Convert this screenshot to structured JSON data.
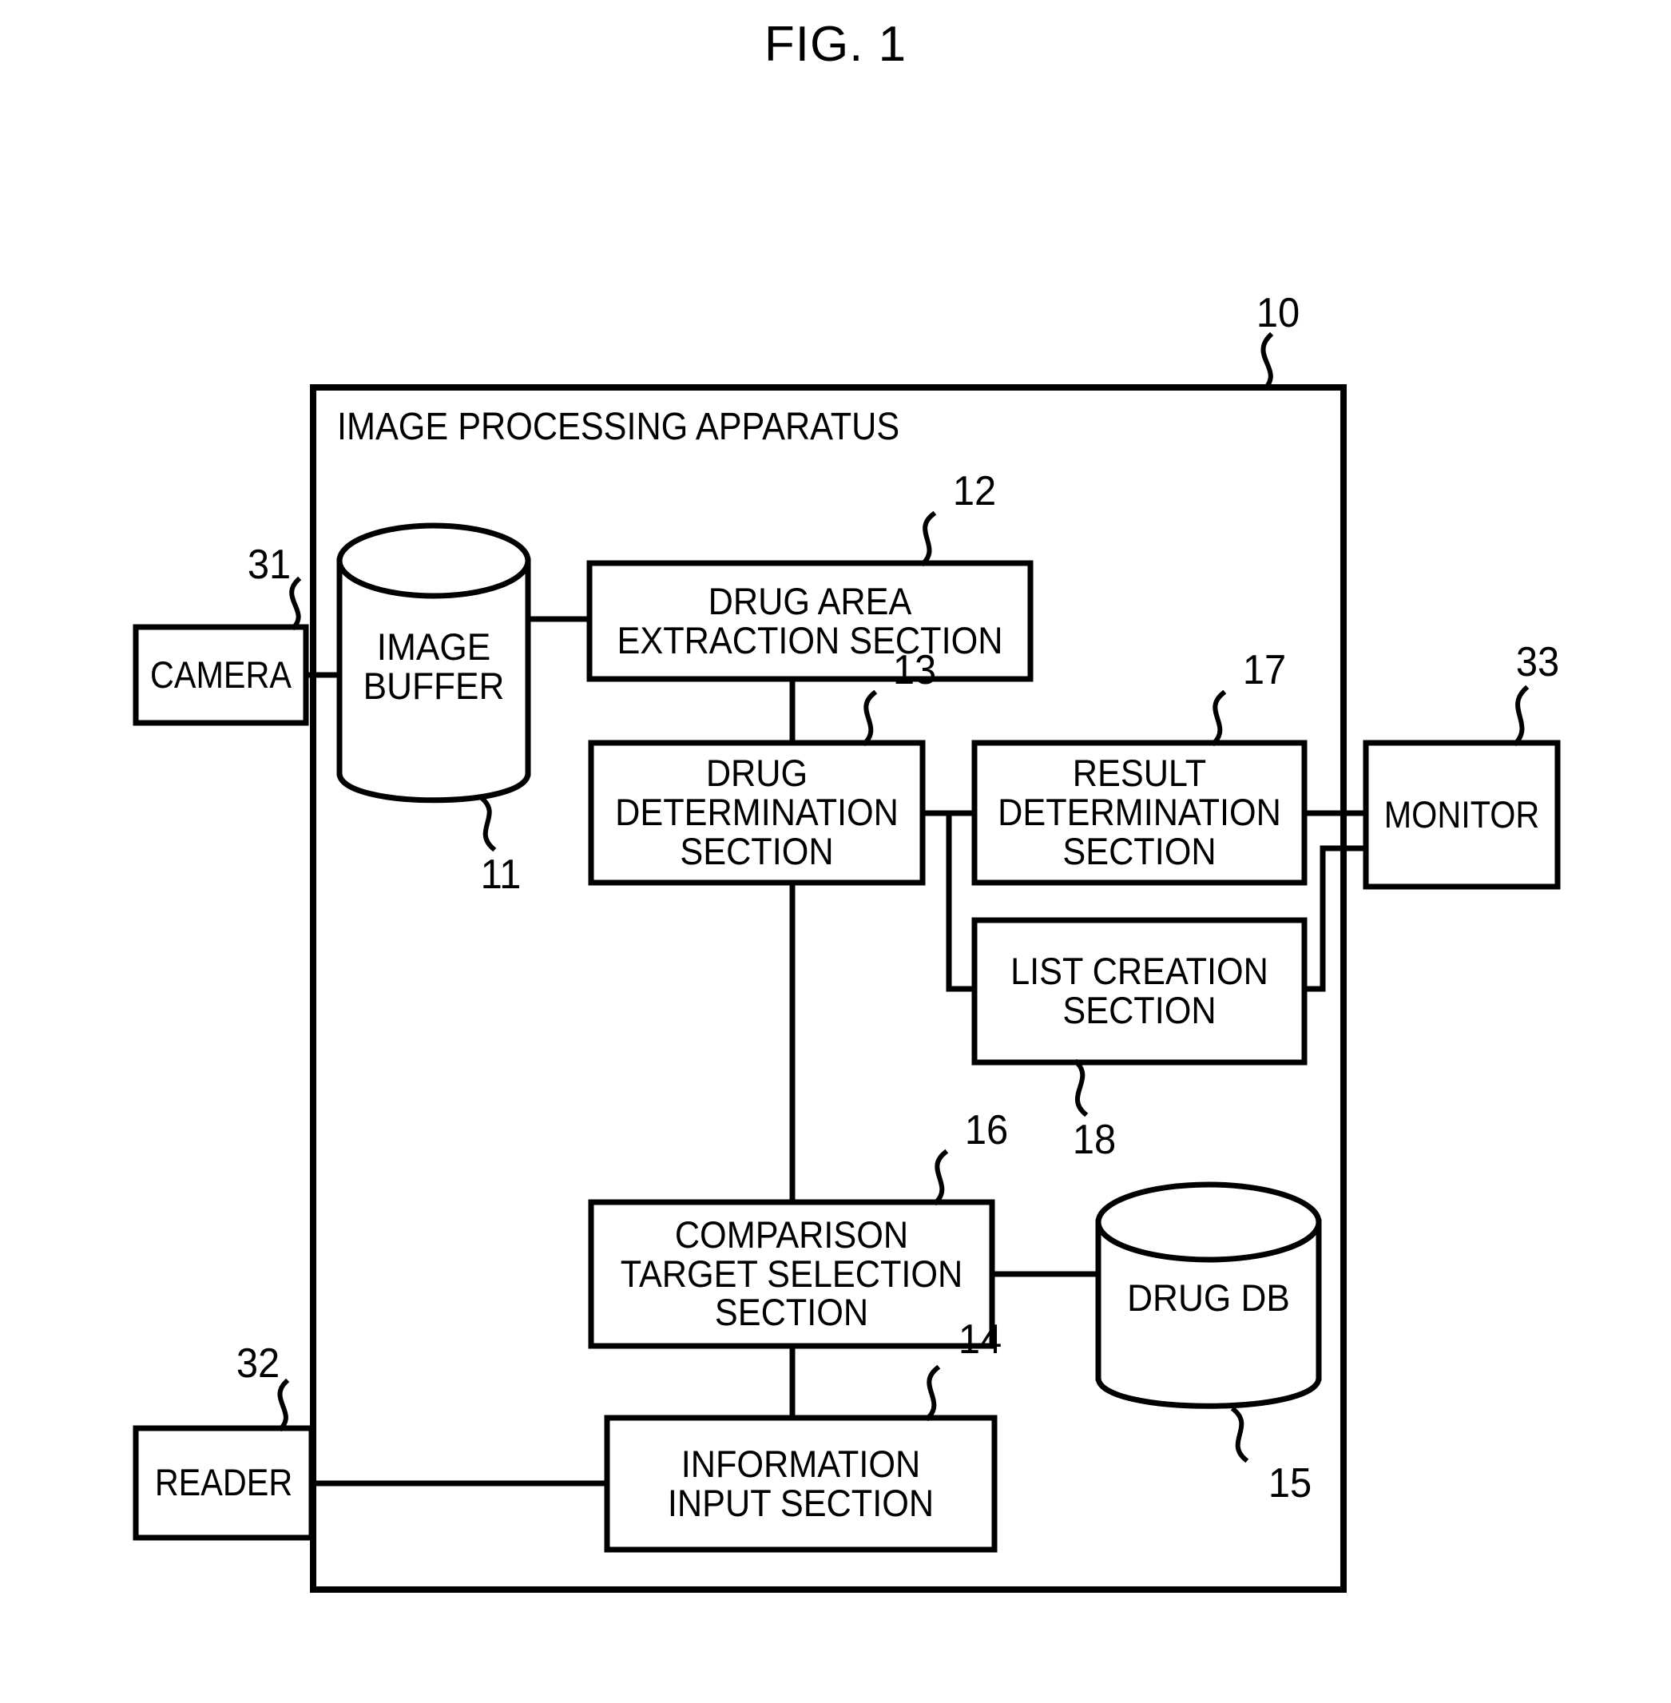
{
  "figure": {
    "title": "FIG. 1",
    "apparatus_label": "IMAGE PROCESSING APPARATUS",
    "apparatus_ref": "10"
  },
  "blocks": {
    "camera": {
      "label": "CAMERA",
      "ref": "31"
    },
    "image_buffer": {
      "label": "IMAGE\nBUFFER",
      "ref": "11"
    },
    "drug_area_extraction": {
      "label": "DRUG AREA\nEXTRACTION SECTION",
      "ref": "12"
    },
    "drug_determination": {
      "label": "DRUG\nDETERMINATION\nSECTION",
      "ref": "13"
    },
    "result_determination": {
      "label": "RESULT\nDETERMINATION\nSECTION",
      "ref": "17"
    },
    "list_creation": {
      "label": "LIST CREATION\nSECTION",
      "ref": "18"
    },
    "monitor": {
      "label": "MONITOR",
      "ref": "33"
    },
    "comparison_target_selection": {
      "label": "COMPARISON\nTARGET SELECTION\nSECTION",
      "ref": "16"
    },
    "drug_db": {
      "label": "DRUG DB",
      "ref": "15"
    },
    "information_input": {
      "label": "INFORMATION\nINPUT SECTION",
      "ref": "14"
    },
    "reader": {
      "label": "READER",
      "ref": "32"
    }
  },
  "style": {
    "ink": "#000000",
    "paper": "#ffffff"
  }
}
